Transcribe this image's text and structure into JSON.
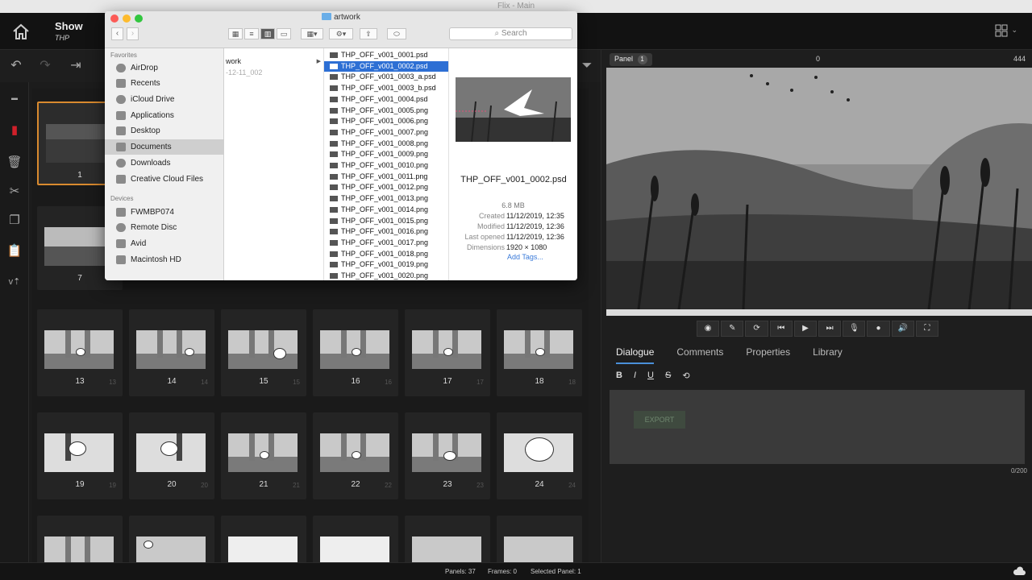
{
  "app": {
    "window_title": "Flix - Main",
    "show_title": "Show",
    "show_sub": "THP"
  },
  "panels": [
    {
      "num": "1",
      "selected": true
    },
    {
      "num": "7"
    },
    {
      "num": "13",
      "sub": "13"
    },
    {
      "num": "14",
      "sub": "14"
    },
    {
      "num": "15",
      "sub": "15"
    },
    {
      "num": "16",
      "sub": "16"
    },
    {
      "num": "17",
      "sub": "17"
    },
    {
      "num": "18",
      "sub": "18"
    },
    {
      "num": "19",
      "sub": "19"
    },
    {
      "num": "20",
      "sub": "20"
    },
    {
      "num": "21",
      "sub": "21"
    },
    {
      "num": "22",
      "sub": "22"
    },
    {
      "num": "23",
      "sub": "23"
    },
    {
      "num": "24",
      "sub": "24"
    }
  ],
  "viewer": {
    "panel_label": "Panel",
    "panel_badge": "1",
    "frame_start": "0",
    "frame_end": "444"
  },
  "tabs": [
    "Dialogue",
    "Comments",
    "Properties",
    "Library"
  ],
  "format": {
    "bold": "B",
    "italic": "I",
    "underline": "U",
    "strike": "S"
  },
  "dialogue": {
    "export_label": "EXPORT",
    "char_count": "0/200"
  },
  "status": {
    "panels": "Panels: 37",
    "frames": "Frames: 0",
    "selected": "Selected Panel: 1"
  },
  "finder": {
    "title": "artwork",
    "search_placeholder": "Search",
    "favorites_label": "Favorites",
    "devices_label": "Devices",
    "favorites": [
      "AirDrop",
      "Recents",
      "iCloud Drive",
      "Applications",
      "Desktop",
      "Documents",
      "Downloads",
      "Creative Cloud Files"
    ],
    "selected_favorite": "Documents",
    "devices": [
      "FWMBP074",
      "Remote Disc",
      "Avid",
      "Macintosh HD"
    ],
    "col1": [
      "work",
      "-12-11_002"
    ],
    "files": [
      "THP_OFF_v001_0001.psd",
      "THP_OFF_v001_0002.psd",
      "THP_OFF_v001_0003_a.psd",
      "THP_OFF_v001_0003_b.psd",
      "THP_OFF_v001_0004.psd",
      "THP_OFF_v001_0005.png",
      "THP_OFF_v001_0006.png",
      "THP_OFF_v001_0007.png",
      "THP_OFF_v001_0008.png",
      "THP_OFF_v001_0009.png",
      "THP_OFF_v001_0010.png",
      "THP_OFF_v001_0011.png",
      "THP_OFF_v001_0012.png",
      "THP_OFF_v001_0013.png",
      "THP_OFF_v001_0014.png",
      "THP_OFF_v001_0015.png",
      "THP_OFF_v001_0016.png",
      "THP_OFF_v001_0017.png",
      "THP_OFF_v001_0018.png",
      "THP_OFF_v001_0019.png",
      "THP_OFF_v001_0020.png"
    ],
    "selected_file_index": 1,
    "preview": {
      "name": "THP_OFF_v001_0002.psd",
      "size": "6.8 MB",
      "meta": [
        {
          "k": "Created",
          "v": "11/12/2019, 12:35"
        },
        {
          "k": "Modified",
          "v": "11/12/2019, 12:36"
        },
        {
          "k": "Last opened",
          "v": "11/12/2019, 12:36"
        },
        {
          "k": "Dimensions",
          "v": "1920 × 1080"
        }
      ],
      "add_tags": "Add Tags..."
    }
  }
}
